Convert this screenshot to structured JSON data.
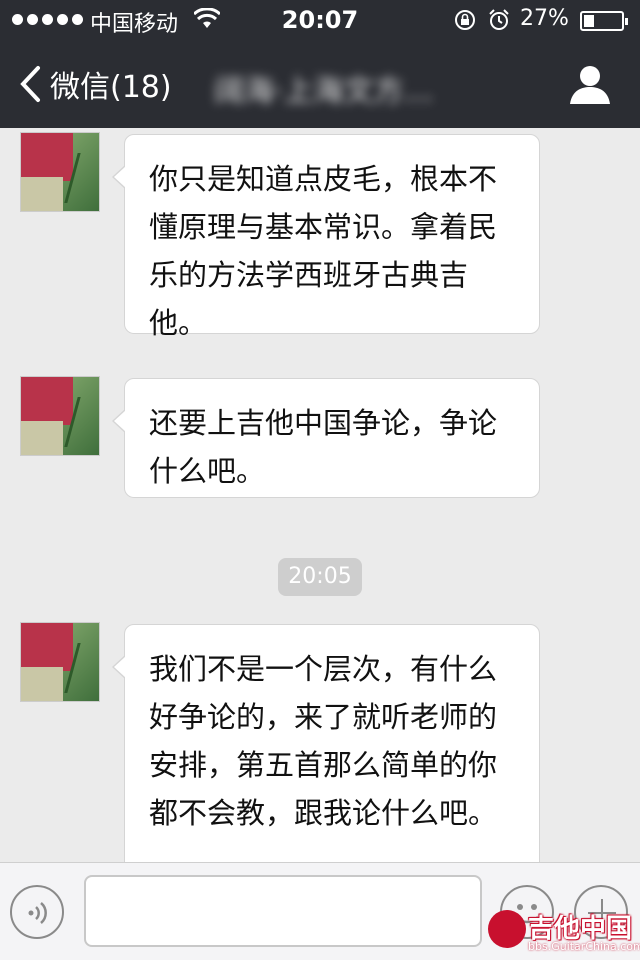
{
  "status_bar": {
    "carrier": "中国移动",
    "time": "20:07",
    "battery_percent": "27%",
    "battery_level": 0.27,
    "icons": [
      "signal-dots",
      "wifi-icon",
      "rotation-lock-icon",
      "alarm-icon",
      "battery-icon"
    ]
  },
  "nav": {
    "back_label": "微信(18)",
    "chat_title": "阔海·上海文方…",
    "profile_icon": "person-icon"
  },
  "messages": [
    {
      "text": "你只是知道点皮毛，根本不懂原理与基本常识。拿着民乐的方法学西班牙古典吉他。"
    },
    {
      "text": "还要上吉他中国争论，争论什么吧。"
    },
    {
      "text": "我们不是一个层次，有什么好争论的，来了就听老师的安排，第五首那么简单的你都不会教，跟我论什么吧。"
    }
  ],
  "timestamp": "20:05",
  "input_bar": {
    "voice_icon": "voice-icon",
    "emoji_icon": "emoji-icon",
    "plus_icon": "plus-icon",
    "text_value": ""
  },
  "watermark": {
    "name": "吉他中国",
    "url": "bbs.GuitarChina.com"
  },
  "colors": {
    "topbar": "#2b2d33",
    "background": "#ebebeb",
    "bubble": "#ffffff",
    "timestamp_bg": "#cecece",
    "watermark_red": "#c8102e"
  }
}
